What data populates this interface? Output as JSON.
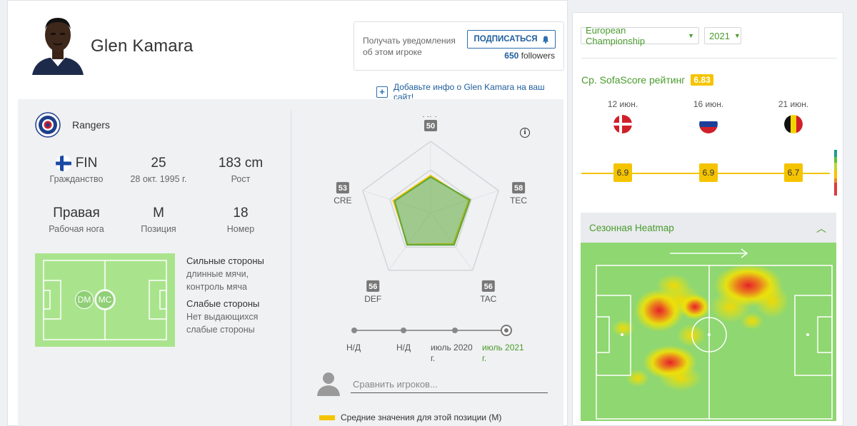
{
  "player": {
    "name": "Glen Kamara"
  },
  "notify": {
    "text": "Получать уведомления об этом игроке",
    "subscribe_label": "ПОДПИСАТЬСЯ",
    "followers_count": "650",
    "followers_word": "followers"
  },
  "add_info": {
    "label": "Добавьте инфо о Glen Kamara на ваш сайт!"
  },
  "team": {
    "name": "Rangers"
  },
  "stats": {
    "nationality": {
      "value": "FIN",
      "label": "Гражданство"
    },
    "age": {
      "value": "25",
      "label": "28 окт. 1995 г."
    },
    "height": {
      "value": "183 cm",
      "label": "Рост"
    },
    "foot": {
      "value": "Правая",
      "label": "Рабочая нога"
    },
    "position": {
      "value": "M",
      "label": "Позиция"
    },
    "number": {
      "value": "18",
      "label": "Номер"
    }
  },
  "positions": [
    "DM",
    "MC"
  ],
  "strengths": {
    "strong_title": "Сильные стороны",
    "strong_items": [
      "длинные мячи,",
      "контроль мяча"
    ],
    "weak_title": "Слабые стороны",
    "weak_items": [
      "Нет выдающихся",
      "слабые стороны"
    ]
  },
  "attributes": {
    "type": "radar",
    "axes": [
      {
        "label": "ATT",
        "value": 50
      },
      {
        "label": "TEC",
        "value": 58
      },
      {
        "label": "TAC",
        "value": 56
      },
      {
        "label": "DEF",
        "value": 56
      },
      {
        "label": "CRE",
        "value": 53
      }
    ],
    "average_values": [
      52,
      56,
      54,
      55,
      55
    ],
    "colors": {
      "player": "#5ea83a",
      "average": "#f5c400"
    }
  },
  "timeline": {
    "labels": [
      "Н/Д",
      "Н/Д",
      "июль 2020 г.",
      "июль 2021 г."
    ]
  },
  "compare": {
    "placeholder": "Сравнить игроков..."
  },
  "legend": {
    "label": "Средние значения для этой позиции (M)"
  },
  "right": {
    "competition": "European Championship",
    "season": "2021",
    "rating_title": "Ср. SofaScore рейтинг",
    "rating_avg": "6.83",
    "matches": [
      {
        "date": "12 июн.",
        "flag": "denmark-flag-icon",
        "rating": "6.9"
      },
      {
        "date": "16 июн.",
        "flag": "russia-flag-icon",
        "rating": "6.9"
      },
      {
        "date": "21 июн.",
        "flag": "belgium-flag-icon",
        "rating": "6.7"
      }
    ],
    "heatmap_title": "Сезонная Heatmap"
  }
}
